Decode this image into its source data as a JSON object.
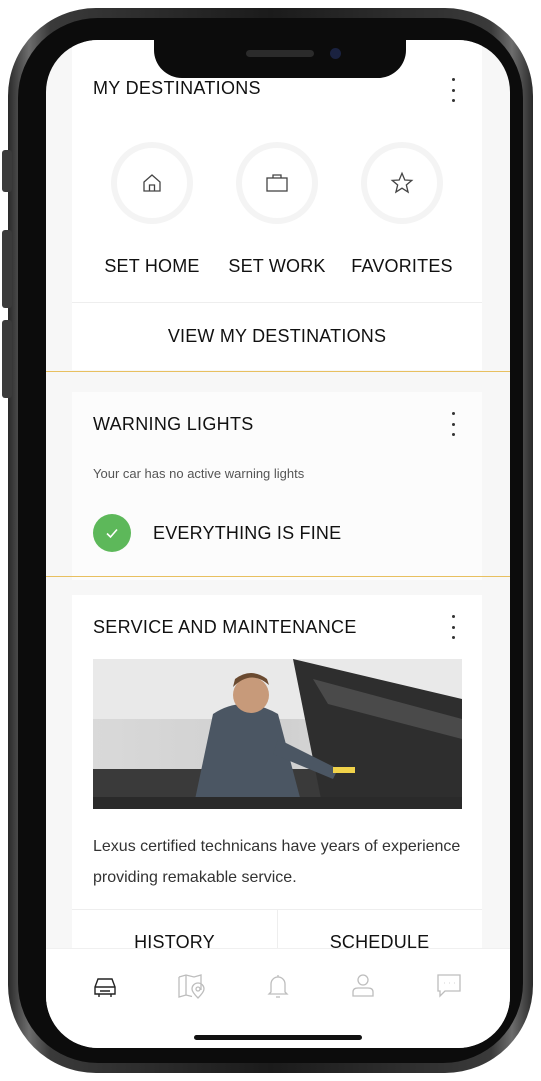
{
  "destinations": {
    "title": "MY DESTINATIONS",
    "items": [
      {
        "label": "SET HOME",
        "icon": "home-icon"
      },
      {
        "label": "SET WORK",
        "icon": "briefcase-icon"
      },
      {
        "label": "FAVORITES",
        "icon": "star-icon"
      }
    ],
    "view_all": "VIEW MY DESTINATIONS"
  },
  "warning": {
    "title": "WARNING LIGHTS",
    "subtitle": "Your car has no active warning lights",
    "status": "EVERYTHING IS FINE",
    "status_color": "#5db85a"
  },
  "service": {
    "title": "SERVICE AND MAINTENANCE",
    "description": "Lexus certified technicans have years of experience providing remakable service.",
    "buttons": {
      "history": "HISTORY",
      "schedule": "SCHEDULE"
    }
  },
  "tabbar": {
    "tabs": [
      {
        "icon": "car-icon",
        "active": true
      },
      {
        "icon": "map-icon",
        "active": false
      },
      {
        "icon": "bell-icon",
        "active": false
      },
      {
        "icon": "user-icon",
        "active": false
      },
      {
        "icon": "chat-icon",
        "active": false
      }
    ]
  },
  "colors": {
    "highlight": "#e8c060",
    "text": "#111111"
  }
}
